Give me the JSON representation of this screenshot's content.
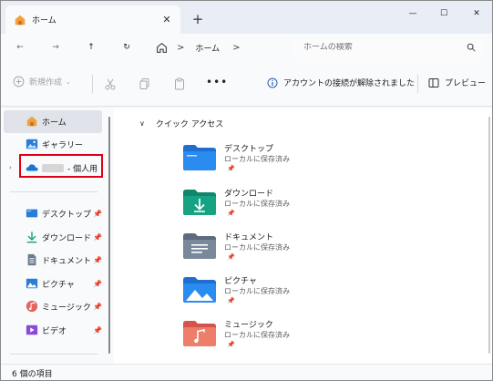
{
  "tab": {
    "title": "ホーム",
    "close_glyph": "✕",
    "new_tab_glyph": "+"
  },
  "window_controls": {
    "minimize": "—",
    "maximize": "☐",
    "close": "✕"
  },
  "nav": {
    "back": "←",
    "forward": "→",
    "up": "↑",
    "refresh": "↻"
  },
  "address": {
    "separator": ">",
    "crumb": "ホーム",
    "trailing_separator": ">"
  },
  "search": {
    "placeholder": "ホームの検索"
  },
  "toolbar": {
    "new_label": "新規作成",
    "more_glyph": "•••",
    "account_status": "アカウントの接続が解除されました",
    "preview_label": "プレビュー"
  },
  "sidebar": {
    "items": [
      {
        "label": "ホーム",
        "icon": "home-icon"
      },
      {
        "label": "ギャラリー",
        "icon": "gallery-icon"
      },
      {
        "label": "- 個人用",
        "icon": "onedrive-cloud-icon"
      },
      {
        "label": "デスクトップ",
        "icon": "desktop-icon",
        "pinned": true
      },
      {
        "label": "ダウンロード",
        "icon": "download-icon",
        "pinned": true
      },
      {
        "label": "ドキュメント",
        "icon": "document-icon",
        "pinned": true
      },
      {
        "label": "ピクチャ",
        "icon": "pictures-icon",
        "pinned": true
      },
      {
        "label": "ミュージック",
        "icon": "music-icon",
        "pinned": true
      },
      {
        "label": "ビデオ",
        "icon": "video-icon",
        "pinned": true
      }
    ],
    "expand_glyph": "›",
    "pin_glyph": "📌"
  },
  "main": {
    "section_title": "クイック アクセス",
    "section_chevron": "∨",
    "items": [
      {
        "name": "デスクトップ",
        "sub": "ローカルに保存済み",
        "icon": "desktop-folder-icon"
      },
      {
        "name": "ダウンロード",
        "sub": "ローカルに保存済み",
        "icon": "download-folder-icon"
      },
      {
        "name": "ドキュメント",
        "sub": "ローカルに保存済み",
        "icon": "document-folder-icon"
      },
      {
        "name": "ピクチャ",
        "sub": "ローカルに保存済み",
        "icon": "pictures-folder-icon"
      },
      {
        "name": "ミュージック",
        "sub": "ローカルに保存済み",
        "icon": "music-folder-icon"
      }
    ]
  },
  "status": {
    "item_count": "6 個の項目"
  },
  "colors": {
    "accent_blue": "#2a7dd6",
    "highlight_red": "#e0001a",
    "selection": "#e0e3ea"
  }
}
